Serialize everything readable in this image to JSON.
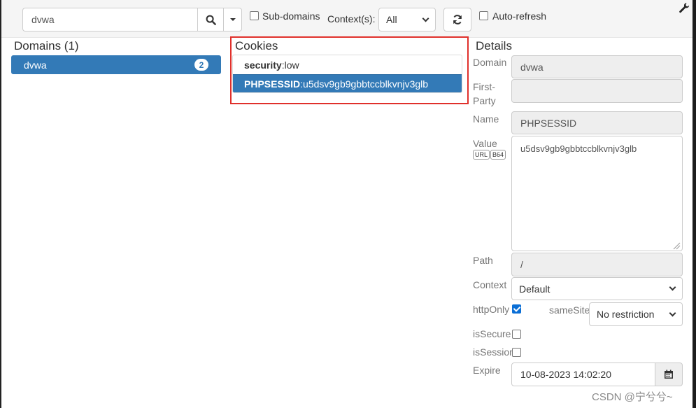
{
  "toolbar": {
    "search_value": "dvwa",
    "subdomains_label": "Sub-domains",
    "contexts_label": "Context(s):",
    "context_selected": "All",
    "autorefresh_label": "Auto-refresh"
  },
  "domains": {
    "title": "Domains (1)",
    "items": [
      {
        "label": "dvwa",
        "count": "2"
      }
    ]
  },
  "cookies": {
    "title": "Cookies",
    "items": [
      {
        "name": "security",
        "value": ":low"
      },
      {
        "name": "PHPSESSID",
        "value": ":u5dsv9gb9gbbtccblkvnjv3glb"
      }
    ]
  },
  "details": {
    "title": "Details",
    "domain_label": "Domain",
    "domain_value": "dvwa",
    "firstparty_label_1": "First-",
    "firstparty_label_2": "Party",
    "firstparty_value": "",
    "name_label": "Name",
    "name_value": "PHPSESSID",
    "value_label": "Value",
    "url_tag": "URL",
    "b64_tag": "B64",
    "value_value": "u5dsv9gb9gbbtccblkvnjv3glb",
    "path_label": "Path",
    "path_value": "/",
    "context_label": "Context",
    "context_value": "Default",
    "httponly_label": "httpOnly",
    "samesite_label": "sameSite",
    "samesite_value": "No restriction",
    "issecure_label": "isSecure",
    "issession_label": "isSession",
    "expire_label": "Expire",
    "expire_value": "10-08-2023 14:02:20"
  },
  "watermark": "CSDN @宁兮兮~",
  "colors": {
    "accent": "#337ab7",
    "highlight_frame": "#e0302b"
  }
}
